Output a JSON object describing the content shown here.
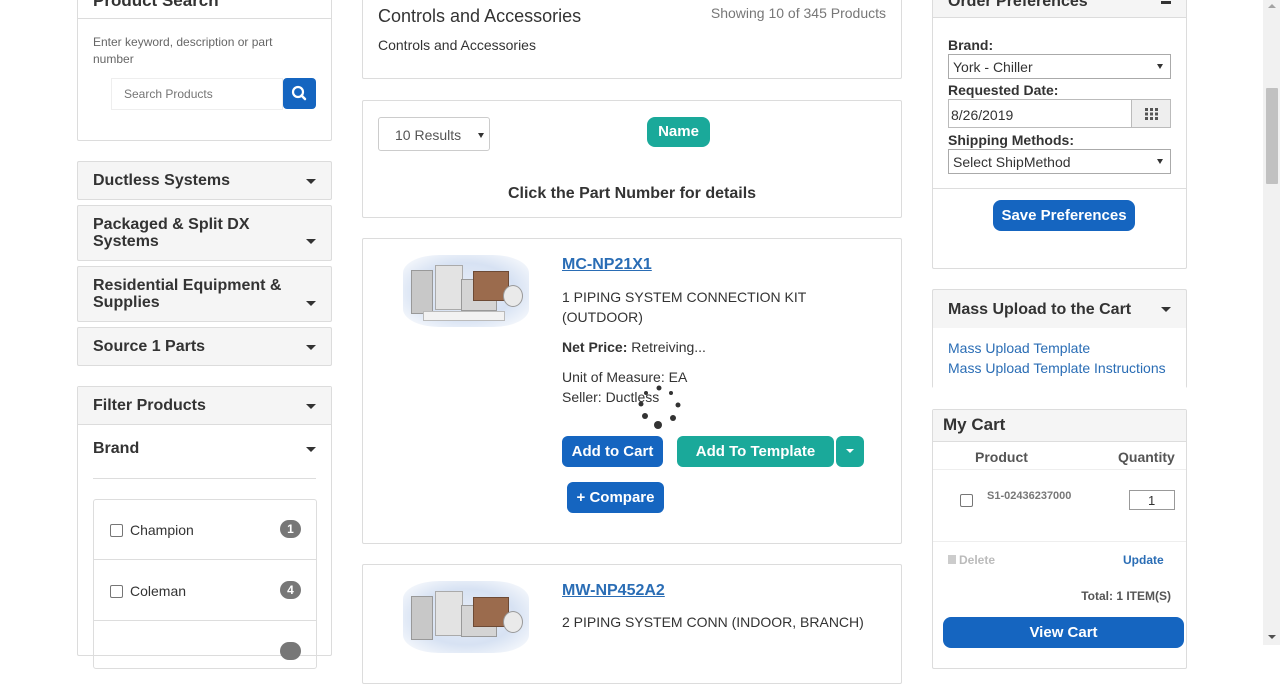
{
  "left": {
    "product_search_title": "Product Search",
    "search_hint": "Enter keyword, description or part number",
    "search_placeholder": "Search Products",
    "categories": [
      {
        "label": "Ductless Systems"
      },
      {
        "label": "Packaged & Split DX Systems"
      },
      {
        "label": "Residential Equipment & Supplies"
      },
      {
        "label": "Source 1 Parts"
      }
    ],
    "filter_title": "Filter Products",
    "brand_title": "Brand",
    "brands": [
      {
        "label": "Champion",
        "count": "1"
      },
      {
        "label": "Coleman",
        "count": "4"
      }
    ]
  },
  "main": {
    "category_title": "Controls and Accessories",
    "showing_text": "Showing 10 of 345 Products",
    "category_subtitle": "Controls and Accessories",
    "results_select": "10 Results",
    "sort_button": "Name",
    "click_hint": "Click the Part Number for details",
    "products": [
      {
        "part_number": "MC-NP21X1",
        "description": "1 PIPING SYSTEM CONNECTION KIT (OUTDOOR)",
        "net_price_label": "Net Price:",
        "net_price_value": "Retreiving...",
        "uom": "Unit of Measure: EA",
        "seller": "Seller: Ductless",
        "add_to_cart": "Add to Cart",
        "add_to_template": "Add To Template",
        "compare": "+ Compare"
      },
      {
        "part_number": "MW-NP452A2",
        "description": "2 PIPING SYSTEM CONN (INDOOR, BRANCH)"
      }
    ]
  },
  "right": {
    "order_prefs_title": "Order Preferences",
    "brand_label": "Brand:",
    "brand_value": "York - Chiller",
    "requested_date_label": "Requested Date:",
    "requested_date_value": "8/26/2019",
    "shipping_label": "Shipping Methods:",
    "shipping_value": "Select ShipMethod",
    "save_prefs": "Save Preferences",
    "mass_upload_title": "Mass Upload to the Cart",
    "mass_upload_template": "Mass Upload Template",
    "mass_upload_instructions": "Mass Upload Template Instructions",
    "cart_title": "My Cart",
    "cart_col_product": "Product",
    "cart_col_quantity": "Quantity",
    "cart_item_part": "S1-02436237000",
    "cart_item_qty": "1",
    "delete_label": "Delete",
    "update_label": "Update",
    "total_label": "Total: 1 ITEM(S)",
    "view_cart": "View Cart"
  },
  "colors": {
    "primary_blue": "#1565c0",
    "teal": "#1aa99a",
    "link_blue": "#2a6db5"
  }
}
